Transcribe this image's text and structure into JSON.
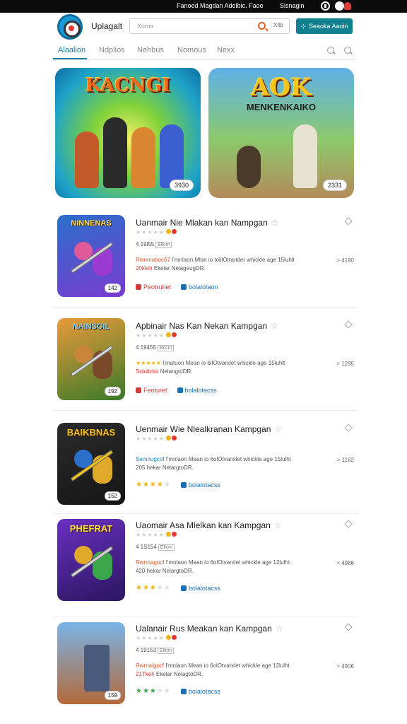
{
  "topbar": {
    "text_left": "Fanoed Magdan  Adelbic. Faoe",
    "text_right": "Sisnagin"
  },
  "header": {
    "app_name": "Uplagalt",
    "search_placeholder": "Xoms",
    "search_tag": "Xltb",
    "cta_label": "Seaoka Aaoin"
  },
  "tabs": [
    "Alaalion",
    "Ndplios",
    "Nehbus",
    "Nomous",
    "Nexx"
  ],
  "featured": [
    {
      "title": "KACNGI",
      "subtitle": "",
      "badge": "3930",
      "colors": [
        "#f6f06a",
        "#1fa3c8"
      ]
    },
    {
      "title": "AOK",
      "subtitle": "MENKENKAIKO",
      "badge": "2331",
      "colors": [
        "#5fb0e8",
        "#b58a5a"
      ]
    }
  ],
  "items": [
    {
      "title": "Uanmair Nie Mlakan kan Nampgan",
      "thumb_label": "NINNENAS",
      "thumb_badge": "142",
      "stars": 0,
      "meta": "4 19l55",
      "meta_box": "Ellcm",
      "desc_line1_hl": "Rwnmaboc67",
      "desc_line1": "I'mnlaon Mlan io tolilOtrarider whickle age 15luhlt",
      "desc_line2_hl": "20kleh",
      "desc_line2": "Ekelar NelageugDR.",
      "price": "> 4190",
      "tag_red": "Peotruhet",
      "tag_blue": "bolalotaon",
      "tag_stars": 0,
      "thumb_colors": [
        "#2a6fc9",
        "#7a3bd0"
      ]
    },
    {
      "title": "Apbinair Nas Kan Nekan Kampgan",
      "thumb_label": "NAINSGIL",
      "thumb_badge": "192",
      "stars": 0,
      "meta": "4 19455",
      "meta_box": "Bccm",
      "desc_line1_hl": "★★★★★",
      "desc_line1": "I'matuon Mean io bilOtvarxlet whickle age 15luhlt",
      "desc_line2_hl": "Soluliclor",
      "desc_line2": "NelangtoDR.",
      "price": "> 1295",
      "tag_red": "Feoturet",
      "tag_blue": "bolalotacss",
      "tag_stars": 0,
      "thumb_colors": [
        "#e89a3a",
        "#3b7a2a"
      ]
    },
    {
      "title": "Uenmair Wie Nlealkranan Kampgan",
      "thumb_label": "BAIKBNAS",
      "thumb_badge": "152",
      "stars": 0,
      "meta": "",
      "meta_box": "",
      "desc_line1_hl": "Semnugcof",
      "desc_line1": "I'mnlaon Mean io 6olOtvanxlet whickle age 15lulht",
      "desc_line2_hl": "205",
      "desc_line2": "hekar NelargtoDR.",
      "price": "> 1162",
      "tag_red": "",
      "tag_blue": "bolalotacss",
      "tag_stars": 4,
      "thumb_colors": [
        "#2b2b2b",
        "#151515"
      ]
    },
    {
      "title": "Uaomair Asa Mlelkan kan Kampgan",
      "thumb_label": "PHEFRAT",
      "thumb_badge": "",
      "stars": 0,
      "meta": "4 1S154",
      "meta_box": "Ellcm",
      "desc_line1_hl": "Rwrmagocf",
      "desc_line1": "I'mnlaon Mean io 6olOtvarxlet whickle age 12lulht",
      "desc_line2_hl": "420",
      "desc_line2": "hekar NelargtoDR.",
      "price": "> 4986",
      "tag_red": "",
      "tag_blue": "bolalotacss",
      "tag_stars": 3,
      "thumb_colors": [
        "#6a2fc0",
        "#2a1660"
      ]
    },
    {
      "title": "Ualanair Rus Meakan kan Kampgan",
      "thumb_label": "",
      "thumb_badge": "159",
      "stars": 0,
      "meta": "4 19153",
      "meta_box": "Ellcm",
      "desc_line1_hl": "Rwrnaigocf",
      "desc_line1": "I'mnlaon Mean io 6olOtvarxlet whickle age 12lulht",
      "desc_line2_hl": "21Tkeh",
      "desc_line2": "Ekelar NelagtoDR.",
      "price": "> 4906",
      "tag_red": "",
      "tag_blue": "bolalotacss",
      "tag_stars": 3,
      "thumb_colors": [
        "#7ab3e8",
        "#b46a3a"
      ]
    }
  ],
  "accent_color": "#10808f"
}
